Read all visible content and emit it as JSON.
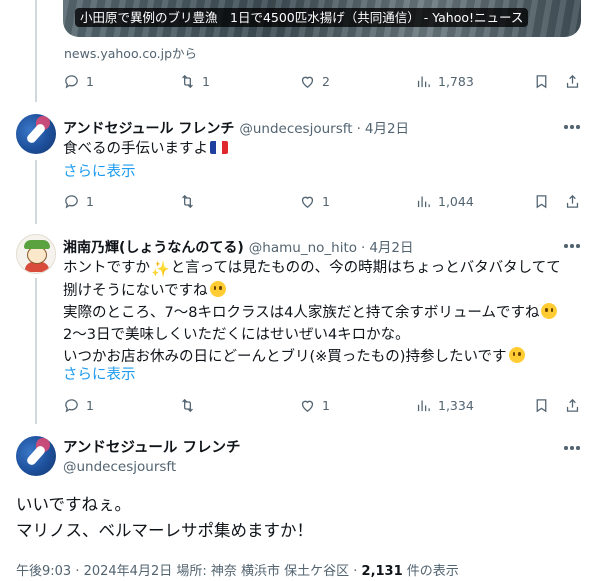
{
  "link_card": {
    "caption": "小田原で異例のブリ豊漁　1日で4500匹水揚げ（共同通信） - Yahoo!ニュース",
    "source": "news.yahoo.co.jpから"
  },
  "top_actions": {
    "replies": "1",
    "retweets": "1",
    "likes": "2",
    "views": "1,783"
  },
  "reply1": {
    "name": "アンドセジュール フレンチ",
    "handle": "@undecesjoursft",
    "separator": "·",
    "date": "4月2日",
    "text": "食べるの手伝いますよ",
    "emoji": "france-flag",
    "show_more": "さらに表示",
    "actions": {
      "replies": "1",
      "retweets": "",
      "likes": "1",
      "views": "1,044"
    }
  },
  "reply2": {
    "name": "湘南乃輝(しょうなんのてる)",
    "handle": "@hamu_no_hito",
    "separator": "·",
    "date": "4月2日",
    "lines": [
      "ホントですか",
      "と言っては見たものの、今の時期はちょっとバタバタしてて",
      "捌けそうにないですね",
      "実際のところ、7〜8キロクラスは4人家族だと持て余すボリュームですね",
      "2〜3日で美味しくいただくにはせいぜい4キロかな。",
      "いつかお店お休みの日にどーんとブリ(※買ったもの)持参したいです"
    ],
    "sparkle": "✨",
    "show_more": "さらに表示",
    "actions": {
      "replies": "1",
      "retweets": "",
      "likes": "1",
      "views": "1,334"
    }
  },
  "main_tweet": {
    "name": "アンドセジュール フレンチ",
    "handle": "@undecesjoursft",
    "line1": "いいですねぇ。",
    "line2": "マリノス、ベルマーレサポ集めますか！",
    "meta_prefix": "午後9:03 · 2024年4月2日 場所: 神奈 横浜市 保土ケ谷区 · ",
    "meta_views": "2,131",
    "meta_suffix": " 件の表示"
  },
  "colors": {
    "link": "#1d9bf0",
    "secondary": "#536471",
    "text": "#0f1419",
    "thread_line": "#cfd9de"
  }
}
